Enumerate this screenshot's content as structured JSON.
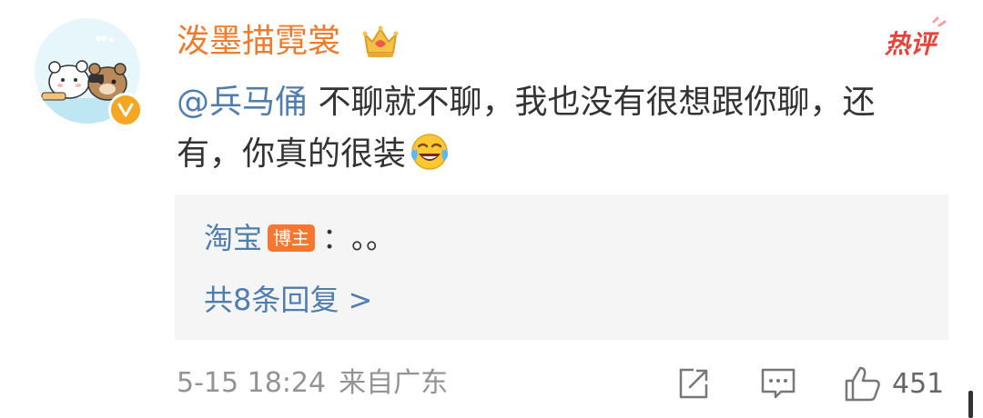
{
  "comment": {
    "username": "泼墨描霓裳",
    "hot_label": "热评",
    "mention": "@兵马俑",
    "text": " 不聊就不聊，我也没有很想跟你聊，还有，你真的很装",
    "reply": {
      "author": "淘宝",
      "badge": "博主",
      "separator": "：",
      "text": "。。"
    },
    "more_replies": "共8条回复 >",
    "date": "5-15 18:24",
    "location": "来自广东",
    "like_count": "451"
  },
  "icons": [
    "avatar",
    "verified-badge-icon",
    "crown-icon",
    "laugh-cry-emoji-icon",
    "share-icon",
    "comment-icon",
    "like-icon"
  ],
  "colors": {
    "username": "#f07c2b",
    "link": "#507daf",
    "hot_tag": "#e8433a",
    "verified": "#f5a623",
    "badge": "#f6772f",
    "meta": "#939393"
  }
}
